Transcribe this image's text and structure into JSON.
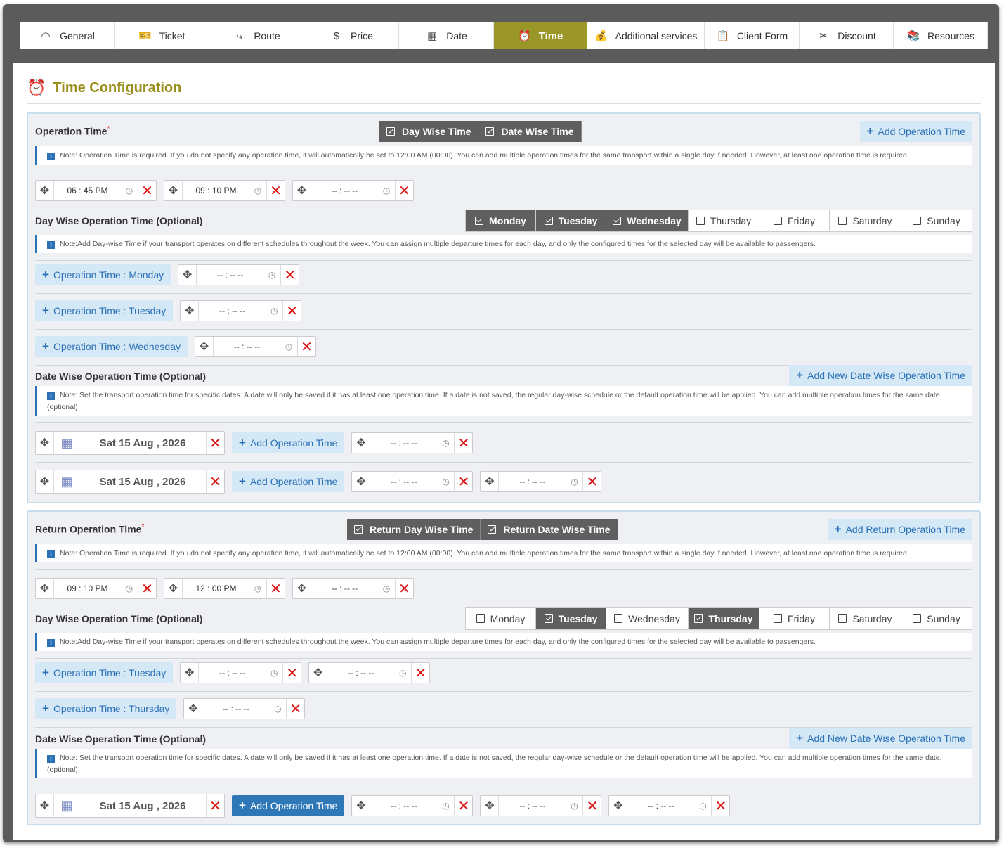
{
  "tabs": [
    {
      "label": "General",
      "icon": "general-icon"
    },
    {
      "label": "Ticket",
      "icon": "ticket-icon"
    },
    {
      "label": "Route",
      "icon": "route-icon"
    },
    {
      "label": "Price",
      "icon": "price-icon"
    },
    {
      "label": "Date",
      "icon": "calendar-icon"
    },
    {
      "label": "Time",
      "icon": "alarm-clock-icon",
      "active": true
    },
    {
      "label": "Additional services",
      "icon": "money-bag-icon"
    },
    {
      "label": "Client Form",
      "icon": "clipboard-icon"
    },
    {
      "label": "Discount",
      "icon": "scissors-icon"
    },
    {
      "label": "Resources",
      "icon": "books-icon"
    }
  ],
  "page_title": "Time Configuration",
  "outbound": {
    "label": "Operation Time",
    "required_mark": "*",
    "toggle_day": "Day Wise Time",
    "toggle_date": "Date Wise Time",
    "add_button": "Add Operation Time",
    "note": "Note: Operation Time is required. If you do not specify any operation time, it will automatically be set to 12:00 AM (00:00). You can add multiple operation times for the same transport within a single day if needed. However, at least one operation time is required.",
    "times": [
      "06 : 45   PM",
      "09 : 10   PM",
      "-- : --   --"
    ],
    "day_wise_label": "Day Wise Operation Time (Optional)",
    "days": [
      {
        "label": "Monday",
        "on": true
      },
      {
        "label": "Tuesday",
        "on": true
      },
      {
        "label": "Wednesday",
        "on": true
      },
      {
        "label": "Thursday",
        "on": false
      },
      {
        "label": "Friday",
        "on": false
      },
      {
        "label": "Saturday",
        "on": false
      },
      {
        "label": "Sunday",
        "on": false
      }
    ],
    "day_note": "Note:Add Day-wise Time if your transport operates on different schedules throughout the week. You can assign multiple departure times for each day, and only the configured times for the selected day will be available to passengers.",
    "day_rows": [
      {
        "button": "Operation Time : Monday",
        "times": [
          "-- : --   --"
        ]
      },
      {
        "button": "Operation Time : Tuesday",
        "times": [
          "-- : --   --"
        ]
      },
      {
        "button": "Operation Time : Wednesday",
        "times": [
          "-- : --   --"
        ]
      }
    ],
    "date_wise_label": "Date Wise Operation Time (Optional)",
    "date_add_button": "Add New Date Wise Operation Time",
    "date_note": "Note: Set the transport operation time for specific dates. A date will only be saved if it has at least one operation time. If a date is not saved, the regular day-wise schedule or the default operation time will be applied. You can add multiple operation times for the same date.(optional)",
    "date_rows": [
      {
        "date": "Sat 15 Aug , 2026",
        "button": "Add Operation Time",
        "times": [
          "-- : --   --"
        ]
      },
      {
        "date": "Sat 15 Aug , 2026",
        "button": "Add Operation Time",
        "times": [
          "-- : --   --",
          "-- : --   --"
        ]
      }
    ]
  },
  "return": {
    "label": "Return Operation Time",
    "required_mark": "*",
    "toggle_day": "Return Day Wise Time",
    "toggle_date": "Return Date Wise Time",
    "add_button": "Add Return Operation Time",
    "note": "Note: Operation Time is required. If you do not specify any operation time, it will automatically be set to 12:00 AM (00:00). You can add multiple operation times for the same transport within a single day if needed. However, at least one operation time is required.",
    "times": [
      "09 : 10   PM",
      "12 : 00   PM",
      "-- : --   --"
    ],
    "day_wise_label": "Day Wise Operation Time (Optional)",
    "days": [
      {
        "label": "Monday",
        "on": false
      },
      {
        "label": "Tuesday",
        "on": true
      },
      {
        "label": "Wednesday",
        "on": false
      },
      {
        "label": "Thursday",
        "on": true
      },
      {
        "label": "Friday",
        "on": false
      },
      {
        "label": "Saturday",
        "on": false
      },
      {
        "label": "Sunday",
        "on": false
      }
    ],
    "day_note": "Note:Add Day-wise Time if your transport operates on different schedules throughout the week. You can assign multiple departure times for each day, and only the configured times for the selected day will be available to passengers.",
    "day_rows": [
      {
        "button": "Operation Time : Tuesday",
        "times": [
          "-- : --   --",
          "-- : --   --"
        ]
      },
      {
        "button": "Operation Time : Thursday",
        "times": [
          "-- : --   --"
        ]
      }
    ],
    "date_wise_label": "Date Wise Operation Time (Optional)",
    "date_add_button": "Add New Date Wise Operation Time",
    "date_note": "Note: Set the transport operation time for specific dates. A date will only be saved if it has at least one operation time. If a date is not saved, the regular day-wise schedule or the default operation time will be applied. You can add multiple operation times for the same date.(optional)",
    "date_rows": [
      {
        "date": "Sat 15 Aug , 2026",
        "button": "Add Operation Time",
        "times": [
          "-- : --   --",
          "-- : --   --",
          "-- : --   --"
        ],
        "solid": true
      }
    ]
  },
  "colors": {
    "active_tab": "#9a9627",
    "title": "#9a8f1c",
    "accent": "#2a70b7",
    "toggle_bg": "#5f5f5f",
    "remove": "#dd1111"
  }
}
